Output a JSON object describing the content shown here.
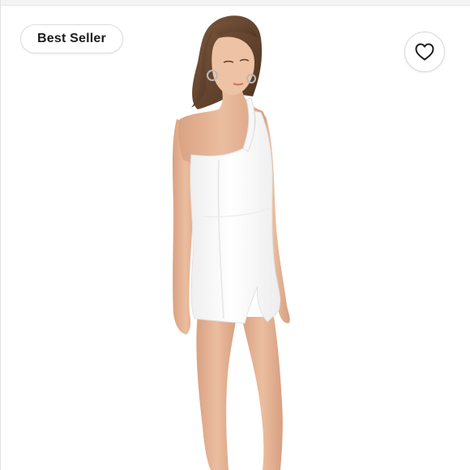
{
  "listing": {
    "badge_label": "Best Seller",
    "like_icon": "heart-outline-icon",
    "photo_subject": "product-photo",
    "colors": {
      "background": "#ffffff",
      "dress": "#fbfbfb",
      "skin": "#e8b89a",
      "hair": "#6b4a33",
      "badge_text": "#1c1c1c",
      "border": "#dcdcdc"
    }
  }
}
